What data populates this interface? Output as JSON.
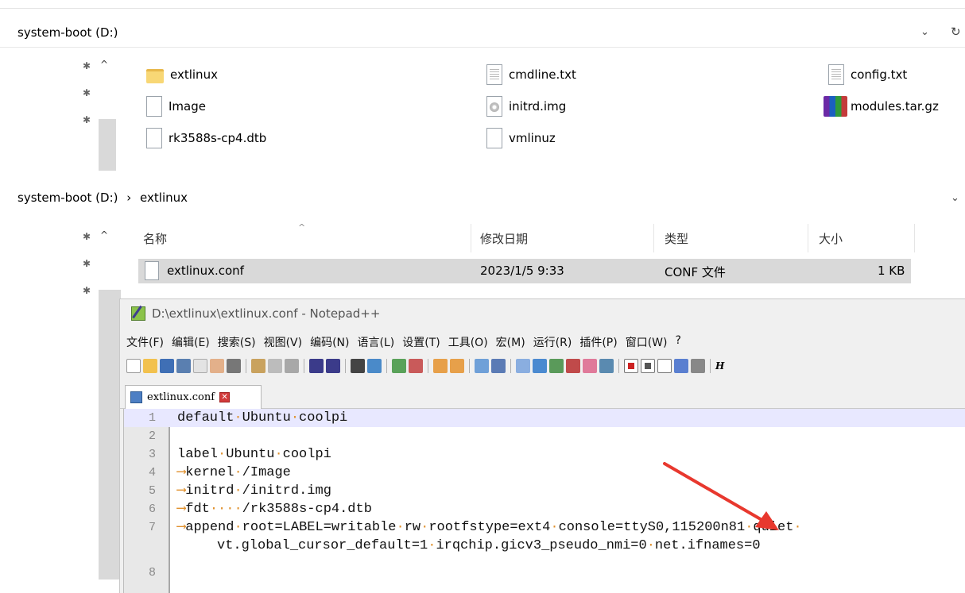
{
  "explorer_top": {
    "breadcrumb": "system-boot (D:)",
    "dropdown_glyph": "⌄",
    "refresh_glyph": "↻",
    "files": [
      {
        "name": "extlinux",
        "icon": "folder-icon"
      },
      {
        "name": "cmdline.txt",
        "icon": "text-file-icon"
      },
      {
        "name": "config.txt",
        "icon": "text-file-icon"
      },
      {
        "name": "Image",
        "icon": "file-icon"
      },
      {
        "name": "initrd.img",
        "icon": "disc-image-icon"
      },
      {
        "name": "modules.tar.gz",
        "icon": "archive-icon"
      },
      {
        "name": "rk3588s-cp4.dtb",
        "icon": "file-icon"
      },
      {
        "name": "vmlinuz",
        "icon": "file-icon"
      }
    ]
  },
  "explorer_bottom": {
    "breadcrumb_root": "system-boot (D:)",
    "breadcrumb_sep": "›",
    "breadcrumb_leaf": "extlinux",
    "dropdown_glyph": "⌄",
    "columns": {
      "name": "名称",
      "modified": "修改日期",
      "type": "类型",
      "size": "大小"
    },
    "rows": [
      {
        "name": "extlinux.conf",
        "modified": "2023/1/5 9:33",
        "type": "CONF 文件",
        "size": "1 KB"
      }
    ]
  },
  "notepad": {
    "title": "D:\\extlinux\\extlinux.conf - Notepad++",
    "menu": [
      "文件(F)",
      "编辑(E)",
      "搜索(S)",
      "视图(V)",
      "编码(N)",
      "语言(L)",
      "设置(T)",
      "工具(O)",
      "宏(M)",
      "运行(R)",
      "插件(P)",
      "窗口(W)",
      "?"
    ],
    "tab_label": "extlinux.conf",
    "tab_close": "✕",
    "toolbar_h_label": "H",
    "lines": [
      {
        "n": "1",
        "text": "default·Ubuntu·coolpi",
        "current": true
      },
      {
        "n": "2",
        "text": ""
      },
      {
        "n": "3",
        "text": "label·Ubuntu·coolpi"
      },
      {
        "n": "4",
        "text": "kernel·/Image",
        "tab": true
      },
      {
        "n": "5",
        "text": "initrd·/initrd.img",
        "tab": true
      },
      {
        "n": "6",
        "text": "fdt····/rk3588s-cp4.dtb",
        "tab": true
      },
      {
        "n": "7",
        "text": "append·root=LABEL=writable·rw·rootfstype=ext4·console=ttyS0,115200n81·quiet·",
        "tab": true
      },
      {
        "n": "",
        "text": "vt.global_cursor_default=1·irqchip.gicv3_pseudo_nmi=0·net.ifnames=0",
        "wrap": true
      },
      {
        "n": "8",
        "text": ""
      }
    ],
    "tab_arrow": "⟶"
  },
  "colors": {
    "current_line": "#e8e8ff",
    "whitespace_marker": "#e0902c",
    "annotation_arrow": "#e8382e",
    "selected_row": "#d9d9d9"
  }
}
